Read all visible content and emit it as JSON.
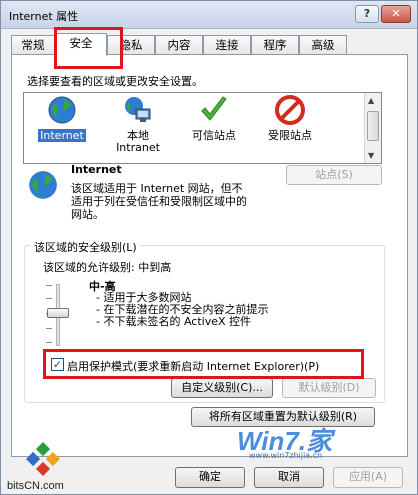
{
  "window": {
    "title": "Internet 属性",
    "help_label": "?",
    "close_label": "✕"
  },
  "tabs": [
    "常规",
    "安全",
    "隐私",
    "内容",
    "连接",
    "程序",
    "高级"
  ],
  "instruction": "选择要查看的区域或更改安全设置。",
  "zones": [
    {
      "icon": "globe-icon",
      "label": "Internet"
    },
    {
      "icon": "local-intranet-icon",
      "label": "本地",
      "label2": "Intranet"
    },
    {
      "icon": "checkmark-icon",
      "label": "可信站点"
    },
    {
      "icon": "restricted-icon",
      "label": "受限站点"
    }
  ],
  "zone_info": {
    "title": "Internet",
    "description": "该区域适用于 Internet 网站，但不适用于列在受信任和受限制区域中的网站。",
    "sites_button": "站点(S)"
  },
  "security_level": {
    "group_title": "该区域的安全级别(L)",
    "allowed_levels": "该区域的允许级别: 中到高",
    "level_name": "中-高",
    "bullets": [
      "- 适用于大多数网站",
      "- 在下载潜在的不安全内容之前提示",
      "- 不下载未签名的 ActiveX 控件"
    ]
  },
  "protected_mode": {
    "label": "启用保护模式(要求重新启动 Internet Explorer)(P)",
    "checked": true
  },
  "buttons": {
    "custom_level": "自定义级别(C)...",
    "default_level": "默认级别(D)",
    "reset_all": "将所有区域重置为默认级别(R)",
    "ok": "确定",
    "cancel": "取消",
    "apply": "应用(A)"
  },
  "watermarks": {
    "left_site": "bitsCN.com",
    "right_brand": "Win7.家",
    "right_url": "www.win7zhijia.cn"
  }
}
